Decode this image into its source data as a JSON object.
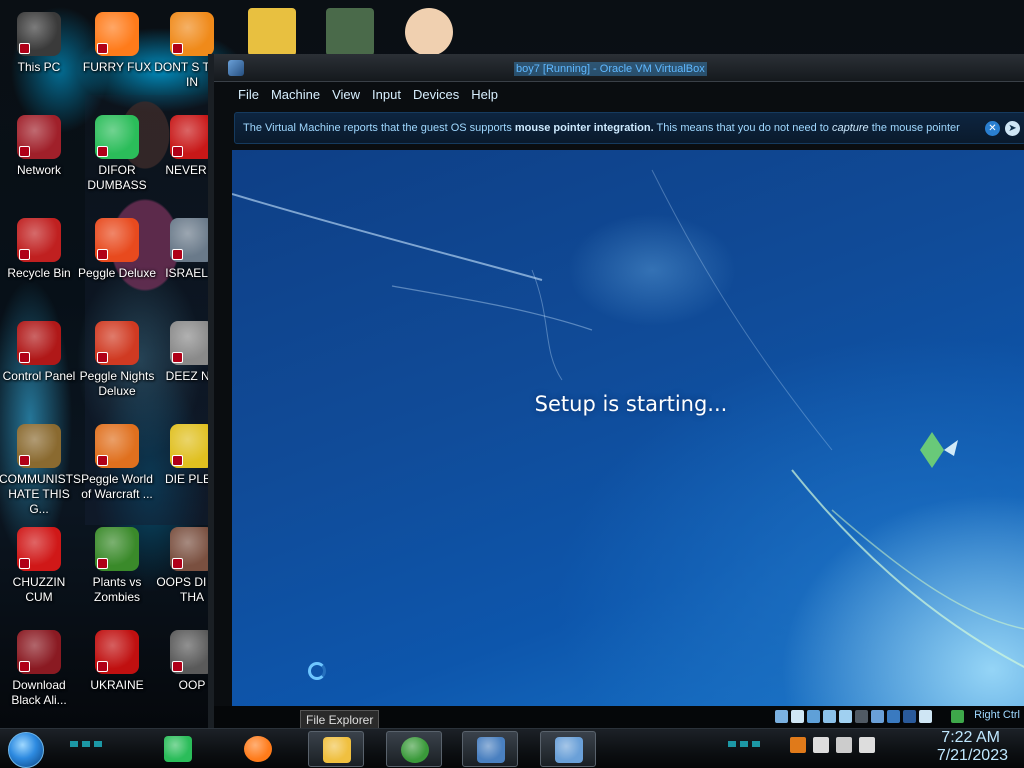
{
  "desktop": {
    "left_column": [
      {
        "label": "This PC",
        "icon": "this-pc-icon",
        "color": "#3a3a3a"
      },
      {
        "label": "Network",
        "icon": "network-icon",
        "color": "#a0202a"
      },
      {
        "label": "Recycle Bin",
        "icon": "recycle-bin-icon",
        "color": "#c02020"
      },
      {
        "label": "Control Panel",
        "icon": "control-panel-icon",
        "color": "#b01818"
      },
      {
        "label": "COMMUNISTS HATE THIS G...",
        "icon": "money-bag-icon",
        "color": "#8a6a30"
      },
      {
        "label": "CHUZZIN CUM",
        "icon": "chuzzle-icon",
        "color": "#d01818"
      },
      {
        "label": "Download Black Ali...",
        "icon": "download-icon",
        "color": "#8a1a22"
      }
    ],
    "middle_column": [
      {
        "label": "FURRY FUX",
        "icon": "firefox-icon",
        "color": "#ff7b1a"
      },
      {
        "label": "DIFOR DUMBASS",
        "icon": "discord-like-icon",
        "color": "#2bbd5a"
      },
      {
        "label": "Peggle Deluxe",
        "icon": "peggle-icon",
        "color": "#e84a1e"
      },
      {
        "label": "Peggle Nights Deluxe",
        "icon": "peggle-nights-icon",
        "color": "#d03a22"
      },
      {
        "label": "Peggle World of Warcraft ...",
        "icon": "peggle-wow-icon",
        "color": "#e0701e"
      },
      {
        "label": "Plants vs Zombies",
        "icon": "plants-vs-zombies-icon",
        "color": "#3a8a2a"
      },
      {
        "label": "UKRAINE",
        "icon": "radiation-icon",
        "color": "#c01010"
      }
    ],
    "right_column": [
      {
        "label": "DONT S THIS IN",
        "icon": "vlc-icon",
        "color": "#f08a1a"
      },
      {
        "label": "NEVER U",
        "icon": "delete-icon",
        "color": "#c81818"
      },
      {
        "label": "ISRAEL S",
        "icon": "window-icon",
        "color": "#6a7a8a"
      },
      {
        "label": "DEEZ NU",
        "icon": "copy-icon",
        "color": "#8a8a8a"
      },
      {
        "label": "DIE PLEA",
        "icon": "die-icon",
        "color": "#e0c020"
      },
      {
        "label": "OOPS DI DO THA",
        "icon": "portrait-icon",
        "color": "#7a5040"
      },
      {
        "label": "OOP",
        "icon": "shortcut-icon",
        "color": "#5a5a5a"
      }
    ],
    "top_row": [
      {
        "icon": "hxd-icon",
        "color": "#e8c040"
      },
      {
        "icon": "puzzle-app-icon",
        "color": "#4a6a4a"
      },
      {
        "icon": "doctor-icon",
        "color": "#f0d0b0"
      }
    ]
  },
  "vbox": {
    "title": "boy7 [Running] - Oracle VM VirtualBox",
    "menu": [
      "File",
      "Machine",
      "View",
      "Input",
      "Devices",
      "Help"
    ],
    "notice_prefix": "The Virtual Machine reports that the guest OS supports ",
    "notice_bold": "mouse pointer integration.",
    "notice_middle": " This means that you do not need to ",
    "notice_italic": "capture",
    "notice_suffix": " the mouse pointer",
    "guest_text": "Setup is starting...",
    "host_key": "Right Ctrl",
    "status_icons": [
      "hard-disk-icon",
      "optical-drive-icon",
      "audio-icon",
      "network-adapter-icon",
      "usb-icon",
      "shared-folder-icon",
      "display-icon",
      "recording-icon",
      "cpu-icon",
      "mouse-integration-icon"
    ]
  },
  "taskbar": {
    "tooltip": "File Explorer",
    "apps": [
      {
        "name": "notes-app",
        "icon": "notes-icon",
        "color": "#2bbd5a"
      },
      {
        "name": "firefox",
        "icon": "firefox-icon",
        "color": "#ff7b1a"
      },
      {
        "name": "file-explorer",
        "icon": "folder-icon",
        "color": "#f0c040"
      },
      {
        "name": "chrome",
        "icon": "chrome-icon",
        "color": "#3a9a3a"
      },
      {
        "name": "virtualbox",
        "icon": "virtualbox-icon",
        "color": "#4a80c0"
      },
      {
        "name": "win7-vm",
        "icon": "windows7-vm-icon",
        "color": "#6aa0d8"
      }
    ],
    "tray_icons": [
      "sublime-icon",
      "flag-icon",
      "network-tray-icon",
      "volume-icon"
    ],
    "time": "7:22 AM",
    "date": "7/21/2023"
  }
}
